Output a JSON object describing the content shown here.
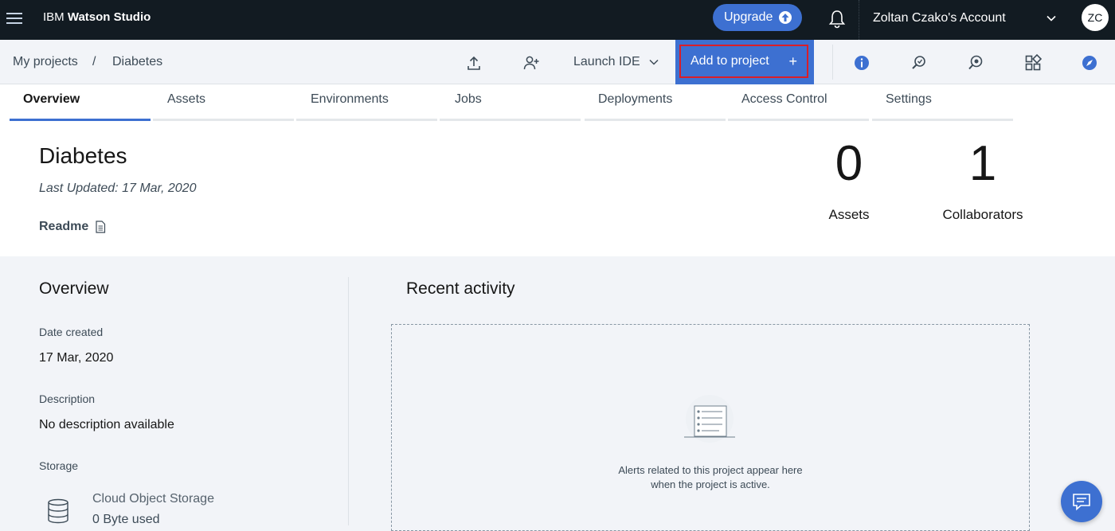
{
  "topbar": {
    "app_name_prefix": "IBM",
    "app_name_product": "Watson Studio",
    "upgrade_label": "Upgrade",
    "account_label": "Zoltan Czako's Account",
    "avatar_initials": "ZC"
  },
  "toolbar": {
    "breadcrumb": [
      "My projects",
      "Diabetes"
    ],
    "breadcrumb_separator": "/",
    "launch_ide_label": "Launch IDE",
    "add_to_project_label": "Add to project",
    "add_plus": "+"
  },
  "tabs": [
    {
      "label": "Overview",
      "active": true
    },
    {
      "label": "Assets",
      "active": false
    },
    {
      "label": "Environments",
      "active": false
    },
    {
      "label": "Jobs",
      "active": false
    },
    {
      "label": "Deployments",
      "active": false
    },
    {
      "label": "Access Control",
      "active": false
    },
    {
      "label": "Settings",
      "active": false
    }
  ],
  "project": {
    "title": "Diabetes",
    "last_updated": "Last Updated: 17 Mar, 2020",
    "readme_label": "Readme",
    "assets_count": "0",
    "assets_label": "Assets",
    "collaborators_count": "1",
    "collaborators_label": "Collaborators"
  },
  "overview": {
    "title": "Overview",
    "date_created_label": "Date created",
    "date_created_value": "17 Mar, 2020",
    "description_label": "Description",
    "description_value": "No description available",
    "storage_label": "Storage",
    "storage_name": "Cloud Object Storage",
    "storage_used": "0 Byte used"
  },
  "activity": {
    "title": "Recent activity",
    "empty_line1": "Alerts related to this project appear here",
    "empty_line2": "when the project is active."
  },
  "colors": {
    "topbar_bg": "#121b22",
    "accent": "#3d70d1",
    "highlight_border": "#da1e28"
  }
}
